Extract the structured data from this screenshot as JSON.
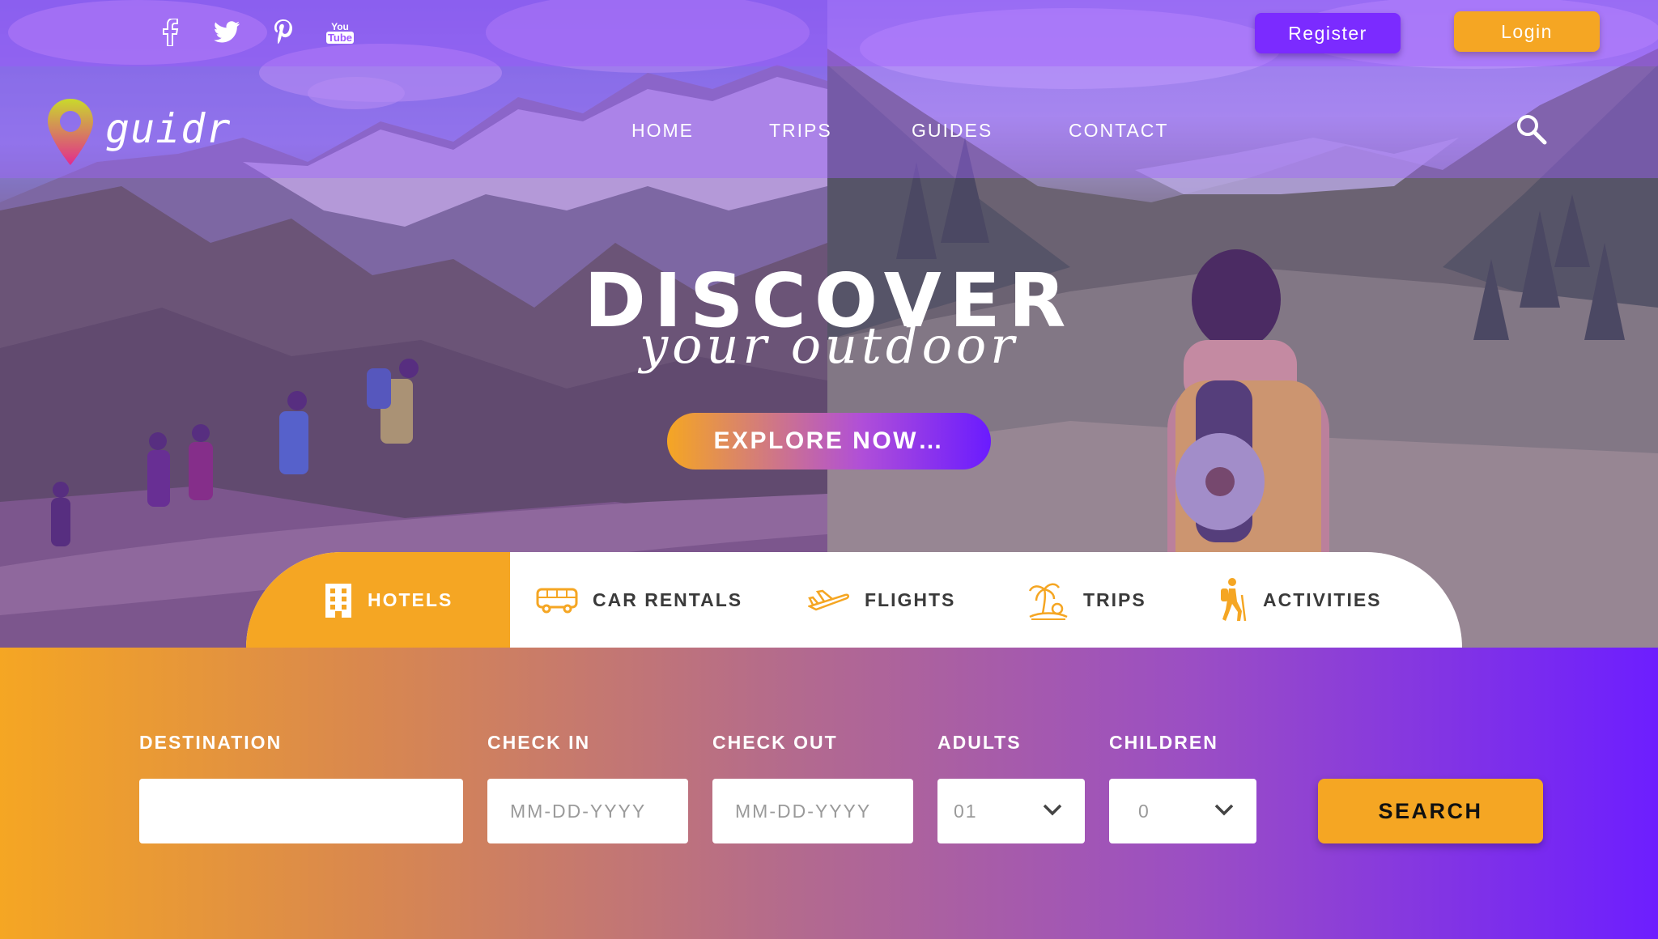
{
  "social": {
    "facebook": "facebook-icon",
    "twitter": "twitter-icon",
    "pinterest": "pinterest-icon",
    "youtube": "youtube-icon",
    "youtube_text_top": "You",
    "youtube_text_bottom": "Tube"
  },
  "auth": {
    "register_label": "Register",
    "login_label": "Login"
  },
  "brand": {
    "name": "guidr"
  },
  "nav": {
    "items": [
      "HOME",
      "TRIPS",
      "GUIDES",
      "CONTACT"
    ],
    "search_icon": "search-icon"
  },
  "hero": {
    "title": "DISCOVER",
    "subtitle": "your outdoor",
    "cta_label": "EXPLORE NOW…"
  },
  "tabs": {
    "items": [
      {
        "label": "HOTELS",
        "icon": "building-icon",
        "active": true
      },
      {
        "label": "CAR RENTALS",
        "icon": "bus-icon",
        "active": false
      },
      {
        "label": "FLIGHTS",
        "icon": "airplane-icon",
        "active": false
      },
      {
        "label": "TRIPS",
        "icon": "palm-tree-icon",
        "active": false
      },
      {
        "label": "ACTIVITIES",
        "icon": "hiker-icon",
        "active": false
      }
    ]
  },
  "search": {
    "destination_label": "DESTINATION",
    "destination_value": "",
    "checkin_label": "CHECK IN",
    "checkin_placeholder": "MM-DD-YYYY",
    "checkout_label": "CHECK OUT",
    "checkout_placeholder": "MM-DD-YYYY",
    "adults_label": "ADULTS",
    "adults_value": "01",
    "children_label": "CHILDREN",
    "children_value": "0",
    "button_label": "SEARCH"
  },
  "colors": {
    "accent_orange": "#f5a623",
    "accent_purple": "#6d1eff",
    "register_purple": "#7b2bff"
  }
}
